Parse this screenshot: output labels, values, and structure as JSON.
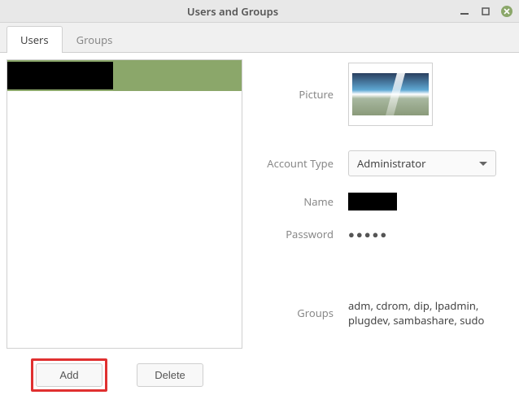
{
  "window": {
    "title": "Users and Groups"
  },
  "tabs": {
    "users": "Users",
    "groups": "Groups"
  },
  "buttons": {
    "add": "Add",
    "delete": "Delete"
  },
  "form": {
    "picture_label": "Picture",
    "account_type_label": "Account Type",
    "account_type_value": "Administrator",
    "name_label": "Name",
    "password_label": "Password",
    "password_value": "●●●●●",
    "groups_label": "Groups",
    "groups_value": "adm, cdrom, dip, lpadmin, plugdev, sambashare, sudo"
  }
}
